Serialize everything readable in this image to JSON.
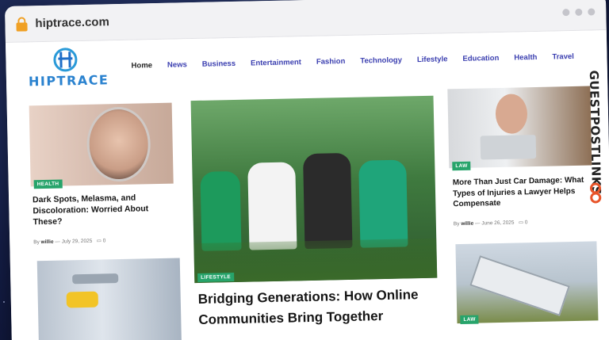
{
  "browser": {
    "url": "hiptrace.com"
  },
  "site": {
    "logo_text": "HIPTRACE",
    "nav": [
      {
        "label": "Home",
        "active": true
      },
      {
        "label": "News"
      },
      {
        "label": "Business"
      },
      {
        "label": "Entertainment"
      },
      {
        "label": "Fashion"
      },
      {
        "label": "Technology"
      },
      {
        "label": "Lifestyle"
      },
      {
        "label": "Education"
      },
      {
        "label": "Health"
      },
      {
        "label": "Travel"
      }
    ]
  },
  "articles": {
    "left_top": {
      "category": "HEALTH",
      "title": "Dark Spots, Melasma, and Discoloration: Worried About These?",
      "by_prefix": "By",
      "author": "willie",
      "date": "July 29, 2025",
      "comments": "0"
    },
    "center": {
      "category": "LIFESTYLE",
      "title": "Bridging Generations: How Online Communities Bring Together"
    },
    "right_top": {
      "category": "LAW",
      "title": "More Than Just Car Damage: What Types of Injuries a Lawyer Helps Compensate",
      "by_prefix": "By",
      "author": "willie",
      "date": "June 26, 2025",
      "comments": "0"
    },
    "right_bottom": {
      "category": "LAW"
    }
  },
  "overlay": {
    "side_text": "GUESTPOSTLINKS"
  },
  "colors": {
    "accent": "#27a46b",
    "nav": "#3b3fb0",
    "background": "#141d45"
  }
}
